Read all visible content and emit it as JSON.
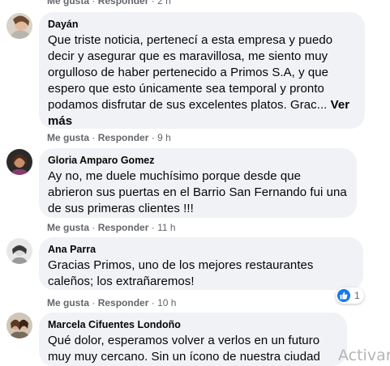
{
  "top_actions": {
    "like": "Me gusta",
    "reply": "Responder",
    "time": "2 h"
  },
  "comments": [
    {
      "author": "Dayán",
      "text": "Que triste noticia, pertenecí a esta empresa y puedo decir y asegurar que es maravillosa, me siento muy orgulloso de haber pertenecido a Primos S.A, y que espero que esto únicamente sea temporal y pronto podamos disfrutar de sus excelentes platos. Grac...",
      "see_more": "Ver más",
      "like": "Me gusta",
      "reply": "Responder",
      "time": "9 h"
    },
    {
      "author": "Gloria Amparo Gomez",
      "text": "Ay no, me duele muchísimo porque desde que abrieron sus puertas en el Barrio San Fernando fui una de sus primeras clientes !!!",
      "like": "Me gusta",
      "reply": "Responder",
      "time": "11 h"
    },
    {
      "author": "Ana Parra",
      "text": "Gracias Primos, uno de los mejores restaurantes caleños; los extrañaremos!",
      "like": "Me gusta",
      "reply": "Responder",
      "time": "10 h",
      "reaction_count": "1"
    },
    {
      "author": "Marcela Cifuentes Londoño",
      "text": "Qué dolor, esperamos volver a verlos en un futuro muy muy cercano. Sin un ícono de nuestra ciudad"
    }
  ],
  "separator": "·",
  "watermark": "Activar",
  "colors": {
    "bubble_bg": "#f0f2f5",
    "meta_text": "#65676b",
    "like_blue": "#1877f2"
  },
  "icons": {
    "reaction": "like-thumb-icon"
  }
}
